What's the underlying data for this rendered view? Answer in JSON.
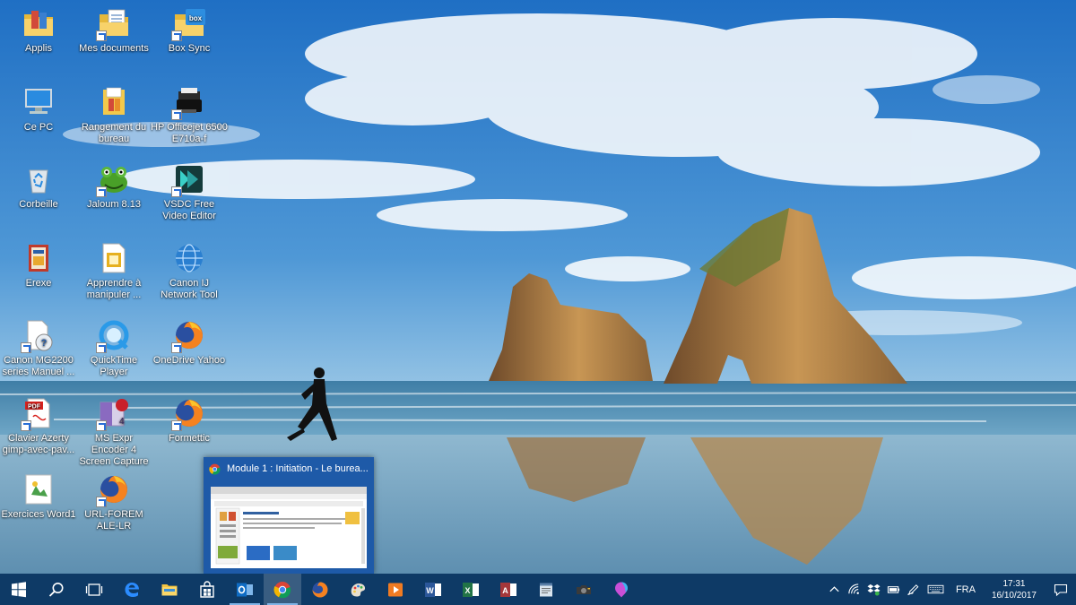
{
  "desktop": {
    "icons": [
      {
        "label": "Applis",
        "icon": "folder-icon"
      },
      {
        "label": "Mes documents",
        "icon": "folder-documents-icon"
      },
      {
        "label": "Box Sync",
        "icon": "box-sync-folder-icon"
      },
      {
        "label": "Ce PC",
        "icon": "computer-icon"
      },
      {
        "label": "Rangement du bureau",
        "icon": "archive-icon"
      },
      {
        "label": "HP Officejet 6500 E710a-f",
        "icon": "printer-icon"
      },
      {
        "label": "Corbeille",
        "icon": "recycle-bin-icon"
      },
      {
        "label": "Jaloum 8.13",
        "icon": "frog-icon"
      },
      {
        "label": "VSDC Free Video Editor",
        "icon": "video-editor-icon"
      },
      {
        "label": "Erexe",
        "icon": "app-icon"
      },
      {
        "label": "Apprendre à manipuler ...",
        "icon": "document-icon"
      },
      {
        "label": "Canon IJ Network Tool",
        "icon": "network-globe-icon"
      },
      {
        "label": "Canon MG2200 series Manuel ...",
        "icon": "help-document-icon"
      },
      {
        "label": "QuickTime Player",
        "icon": "quicktime-icon"
      },
      {
        "label": "OneDrive Yahoo",
        "icon": "firefox-icon"
      },
      {
        "label": "Clavier Azerty gimp-avec-pav...",
        "icon": "pdf-icon"
      },
      {
        "label": "MS Expr Encoder 4 Screen Capture",
        "icon": "encoder-icon"
      },
      {
        "label": "Formettic",
        "icon": "firefox-icon"
      },
      {
        "label": "Exercices Word1",
        "icon": "word-document-icon"
      },
      {
        "label": "URL-FOREM ALE-LR",
        "icon": "firefox-icon"
      }
    ]
  },
  "preview": {
    "title": "Module 1 : Initiation - Le burea...",
    "icon": "chrome-icon"
  },
  "taskbar": {
    "buttons": [
      {
        "name": "start-button",
        "icon": "windows-icon"
      },
      {
        "name": "search-button",
        "icon": "search-icon"
      },
      {
        "name": "task-view-button",
        "icon": "task-view-icon"
      },
      {
        "name": "edge-button",
        "icon": "edge-icon"
      },
      {
        "name": "file-explorer-button",
        "icon": "folder-icon"
      },
      {
        "name": "store-button",
        "icon": "store-icon"
      },
      {
        "name": "outlook-button",
        "icon": "outlook-icon"
      },
      {
        "name": "chrome-button",
        "icon": "chrome-icon"
      },
      {
        "name": "firefox-button",
        "icon": "firefox-icon"
      },
      {
        "name": "paint-button",
        "icon": "paint-icon"
      },
      {
        "name": "media-button",
        "icon": "media-icon"
      },
      {
        "name": "word-button",
        "icon": "word-icon"
      },
      {
        "name": "excel-button",
        "icon": "excel-icon"
      },
      {
        "name": "access-button",
        "icon": "access-icon"
      },
      {
        "name": "notepad-button",
        "icon": "notepad-icon"
      },
      {
        "name": "camera-button",
        "icon": "camera-icon"
      },
      {
        "name": "maps-button",
        "icon": "balloon-icon"
      }
    ],
    "tray": {
      "language": "FRA",
      "time": "17:31",
      "date": "16/10/2017"
    }
  },
  "colors": {
    "taskbar": "#0e3a66",
    "preview": "#1e5aa8",
    "accent": "#7fb3e6"
  }
}
